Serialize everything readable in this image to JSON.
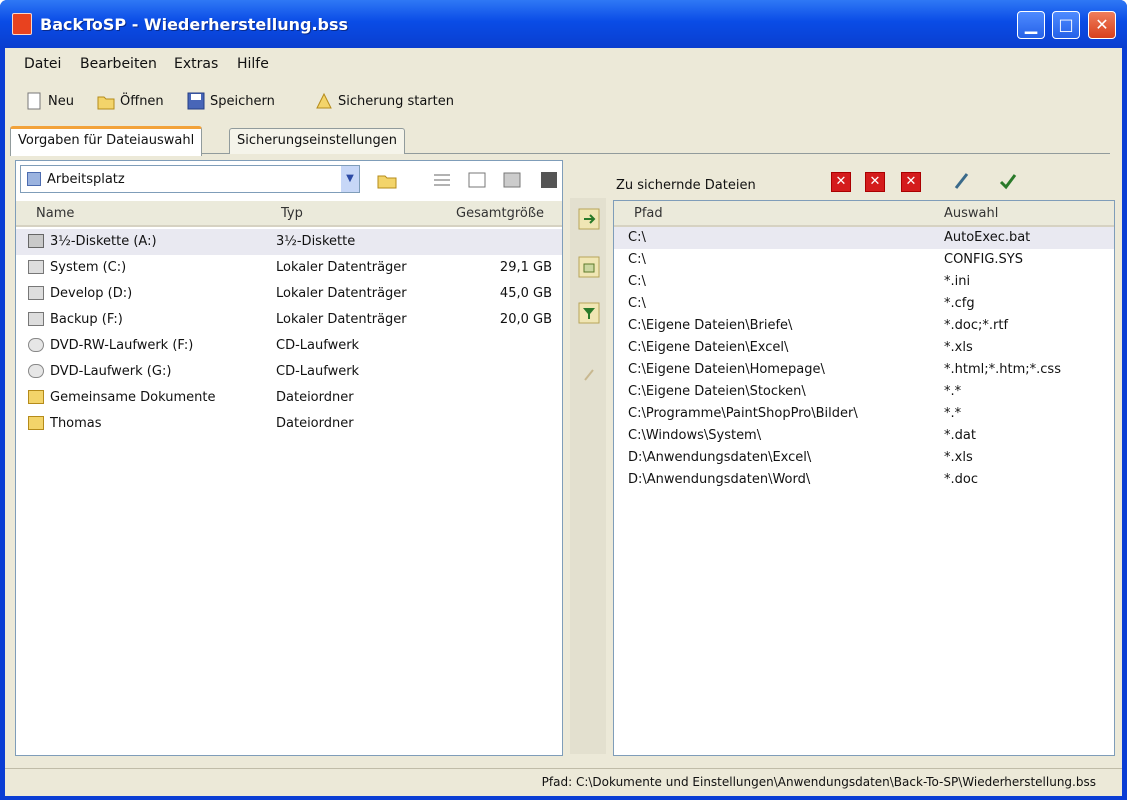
{
  "window": {
    "title": "BackToSP - Wiederherstellung.bss"
  },
  "menu": [
    "Datei",
    "Bearbeiten",
    "Extras",
    "Hilfe"
  ],
  "toolbar": {
    "new": "Neu",
    "open": "Öffnen",
    "save": "Speichern",
    "start": "Sicherung starten"
  },
  "tabs": [
    "Vorgaben für Dateiauswahl",
    "Sicherungseinstellungen"
  ],
  "left": {
    "drive_select": "Arbeitsplatz",
    "columns": {
      "name": "Name",
      "type": "Typ",
      "size": "Gesamtgröße"
    },
    "rows": [
      {
        "name": "3½-Diskette (A:)",
        "type": "3½-Diskette",
        "size": ""
      },
      {
        "name": "System (C:)",
        "type": "Lokaler Datenträger",
        "size": "29,1 GB"
      },
      {
        "name": "Develop (D:)",
        "type": "Lokaler Datenträger",
        "size": "45,0 GB"
      },
      {
        "name": "Backup (F:)",
        "type": "Lokaler Datenträger",
        "size": "20,0 GB"
      },
      {
        "name": "DVD-RW-Laufwerk (F:)",
        "type": "CD-Laufwerk",
        "size": ""
      },
      {
        "name": "DVD-Laufwerk (G:)",
        "type": "CD-Laufwerk",
        "size": ""
      },
      {
        "name": "Gemeinsame Dokumente",
        "type": "Dateiordner",
        "size": ""
      },
      {
        "name": "Thomas",
        "type": "Dateiordner",
        "size": ""
      }
    ]
  },
  "right": {
    "title": "Zu sichernde Dateien",
    "columns": {
      "path": "Pfad",
      "selection": "Auswahl"
    },
    "rows": [
      {
        "path": "C:\\",
        "selection": "AutoExec.bat"
      },
      {
        "path": "C:\\",
        "selection": "CONFIG.SYS"
      },
      {
        "path": "C:\\",
        "selection": "*.ini"
      },
      {
        "path": "C:\\",
        "selection": "*.cfg"
      },
      {
        "path": "C:\\Eigene Dateien\\Briefe\\",
        "selection": "*.doc;*.rtf"
      },
      {
        "path": "C:\\Eigene Dateien\\Excel\\",
        "selection": "*.xls"
      },
      {
        "path": "C:\\Eigene Dateien\\Homepage\\",
        "selection": "*.html;*.htm;*.css"
      },
      {
        "path": "C:\\Eigene Dateien\\Stocken\\",
        "selection": "*.*"
      },
      {
        "path": "C:\\Programme\\PaintShopPro\\Bilder\\",
        "selection": "*.*"
      },
      {
        "path": "C:\\Windows\\System\\",
        "selection": "*.dat"
      },
      {
        "path": "D:\\Anwendungsdaten\\Excel\\",
        "selection": "*.xls"
      },
      {
        "path": "D:\\Anwendungsdaten\\Word\\",
        "selection": "*.doc"
      }
    ]
  },
  "status": "Pfad: C:\\Dokumente und Einstellungen\\Anwendungsdaten\\Back-To-SP\\Wiederherstellung.bss",
  "colors": {
    "titlebar": "#0a4ce6",
    "client": "#ece9d8",
    "delete": "#d41c1c"
  }
}
